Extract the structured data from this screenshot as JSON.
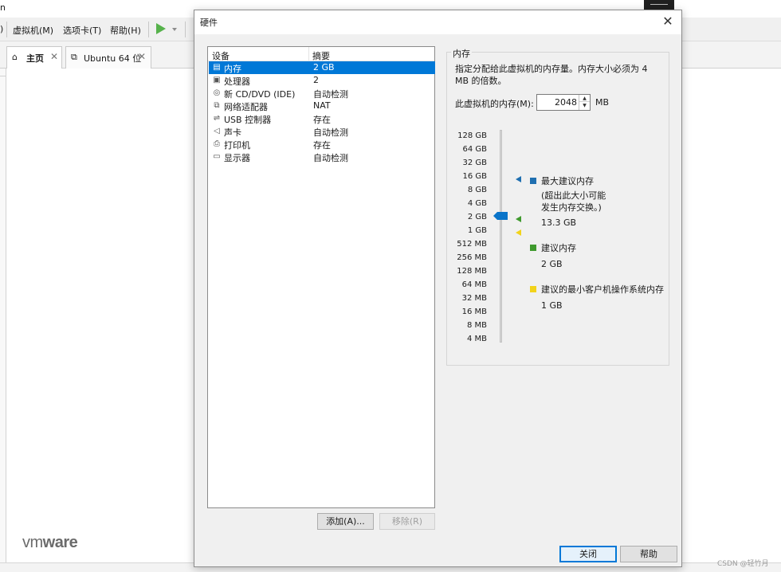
{
  "background": {
    "title_fragment": "n",
    "menus": [
      "虚拟机(M)",
      "选项卡(T)",
      "帮助(H)"
    ],
    "menu_left_fragment": ")",
    "tabs": [
      {
        "label": "主页",
        "active": true
      },
      {
        "label": "Ubuntu 64 位",
        "active": false
      }
    ],
    "logo": {
      "prefix": "vm",
      "suffix": "ware"
    },
    "credit": "CSDN @轻竹月"
  },
  "dialog": {
    "title": "硬件",
    "close_glyph": "✕",
    "columns": {
      "device": "设备",
      "summary": "摘要"
    },
    "devices": [
      {
        "icon": "memory-icon",
        "glyph": "▤",
        "device": "内存",
        "summary": "2 GB",
        "selected": true
      },
      {
        "icon": "processor-icon",
        "glyph": "▣",
        "device": "处理器",
        "summary": "2",
        "selected": false
      },
      {
        "icon": "cd-dvd-icon",
        "glyph": "◎",
        "device": "新 CD/DVD (IDE)",
        "summary": "自动检测",
        "selected": false
      },
      {
        "icon": "network-adapter-icon",
        "glyph": "⧉",
        "device": "网络适配器",
        "summary": "NAT",
        "selected": false
      },
      {
        "icon": "usb-controller-icon",
        "glyph": "⇌",
        "device": "USB 控制器",
        "summary": "存在",
        "selected": false
      },
      {
        "icon": "sound-card-icon",
        "glyph": "◁",
        "device": "声卡",
        "summary": "自动检测",
        "selected": false
      },
      {
        "icon": "printer-icon",
        "glyph": "⎙",
        "device": "打印机",
        "summary": "存在",
        "selected": false
      },
      {
        "icon": "display-icon",
        "glyph": "▭",
        "device": "显示器",
        "summary": "自动检测",
        "selected": false
      }
    ],
    "buttons": {
      "add": "添加(A)...",
      "remove": "移除(R)",
      "close": "关闭",
      "help": "帮助"
    },
    "memory": {
      "legend": "内存",
      "description": "指定分配给此虚拟机的内存量。内存大小必须为 4 MB 的倍数。",
      "field_label": "此虚拟机的内存(M):",
      "value": "2048",
      "unit": "MB",
      "spin_up": "▲",
      "spin_down": "▼",
      "scale_labels": [
        "128 GB",
        "64 GB",
        "32 GB",
        "16 GB",
        "8 GB",
        "4 GB",
        "2 GB",
        "1 GB",
        "512 MB",
        "256 MB",
        "128 MB",
        "64 MB",
        "32 MB",
        "16 MB",
        "8 MB",
        "4 MB"
      ],
      "current_value": "2 GB",
      "markers": {
        "max_recommended": {
          "label": "最大建议内存",
          "note": "(超出此大小可能\n发生内存交换。)",
          "value": "13.3 GB",
          "color": "#1f6fb0"
        },
        "recommended": {
          "label": "建议内存",
          "value": "2 GB",
          "color": "#3f9a2e"
        },
        "min_guest": {
          "label": "建议的最小客户机操作系统内存",
          "value": "1 GB",
          "color": "#f2d31b"
        }
      },
      "slider_color": "#0a74c9"
    }
  }
}
